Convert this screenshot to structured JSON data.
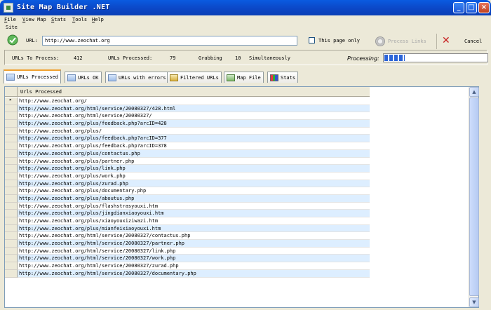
{
  "window": {
    "title": "Site Map Builder .NET"
  },
  "menu": [
    {
      "accel": "F",
      "rest": "ile"
    },
    {
      "accel": "V",
      "rest": "iew Map"
    },
    {
      "accel": "S",
      "rest": "tats"
    },
    {
      "accel": "T",
      "rest": "ools"
    },
    {
      "accel": "H",
      "rest": "elp"
    }
  ],
  "site_label": "Site",
  "toolbar": {
    "url_label": "URL:",
    "url_value": "http://www.zeochat.org",
    "this_page_only_label": "This page only",
    "this_page_only_checked": false,
    "process_label": "Process Links",
    "cancel_label": "Cancel"
  },
  "status": {
    "to_process_label": "URLs To Process:",
    "to_process_value": "412",
    "processed_label": "URLs Processed:",
    "processed_value": "79",
    "grabbing_label": "Grabbing",
    "grabbing_value": "10",
    "simultaneously_label": "Simultaneously",
    "processing_label": "Processing:",
    "progress_fraction": 0.2
  },
  "tabs": [
    {
      "label": "URLs Processed",
      "icon": "globe-icon",
      "active": true
    },
    {
      "label": "URLs OK",
      "icon": "page-ok-icon",
      "active": false
    },
    {
      "label": "URLs with errors",
      "icon": "page-error-icon",
      "active": false
    },
    {
      "label": "Filtered URLs",
      "icon": "filter-icon",
      "active": false
    },
    {
      "label": "Map File",
      "icon": "map-file-icon",
      "active": false
    },
    {
      "label": "Stats",
      "icon": "stats-icon",
      "active": false
    }
  ],
  "grid": {
    "column_header": "Urls Processed",
    "rows": [
      "http://www.zeochat.org/",
      "http://www.zeochat.org/html/service/20080327/428.html",
      "http://www.zeochat.org/html/service/20080327/",
      "http://www.zeochat.org/plus/feedback.php?arcID=428",
      "http://www.zeochat.org/plus/",
      "http://www.zeochat.org/plus/feedback.php?arcID=377",
      "http://www.zeochat.org/plus/feedback.php?arcID=378",
      "http://www.zeochat.org/plus/contactus.php",
      "http://www.zeochat.org/plus/partner.php",
      "http://www.zeochat.org/plus/link.php",
      "http://www.zeochat.org/plus/work.php",
      "http://www.zeochat.org/plus/zurad.php",
      "http://www.zeochat.org/plus/documentary.php",
      "http://www.zeochat.org/plus/aboutus.php",
      "http://www.zeochat.org/plus/flashstrasyouxi.htm",
      "http://www.zeochat.org/plus/jingdianxiaoyouxi.htm",
      "http://www.zeochat.org/plus/xiaoyouxiziwazi.htm",
      "http://www.zeochat.org/plus/mianfeixiaoyouxi.htm",
      "http://www.zeochat.org/html/service/20080327/contactus.php",
      "http://www.zeochat.org/html/service/20080327/partner.php",
      "http://www.zeochat.org/html/service/20080327/link.php",
      "http://www.zeochat.org/html/service/20080327/work.php",
      "http://www.zeochat.org/html/service/20080327/zurad.php",
      "http://www.zeochat.org/html/service/20080327/documentary.php"
    ]
  }
}
